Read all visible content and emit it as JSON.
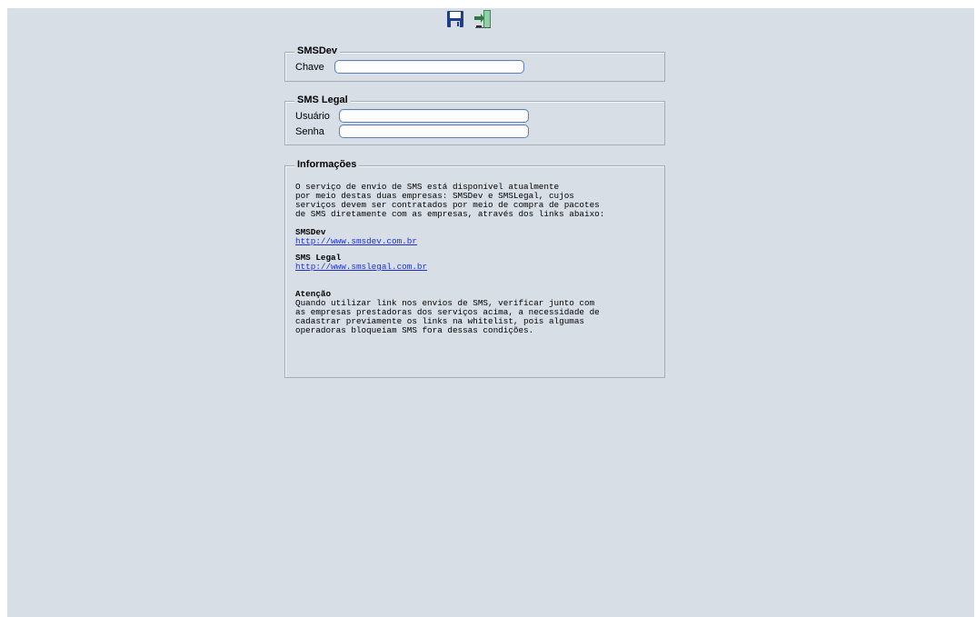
{
  "toolbar": {
    "save_icon": "floppy-disk-icon",
    "exit_icon": "exit-door-icon"
  },
  "smsdev": {
    "legend": "SMSDev",
    "chave_label": "Chave",
    "chave_value": ""
  },
  "smslegal": {
    "legend": "SMS Legal",
    "usuario_label": "Usuário",
    "usuario_value": "",
    "senha_label": "Senha",
    "senha_value": ""
  },
  "info": {
    "legend": "Informações",
    "intro_lines": [
      "O serviço de envio de SMS está disponível atualmente",
      "por meio destas duas empresas: SMSDev e SMSLegal, cujos",
      "serviços devem ser contratados por meio de compra de pacotes",
      "de SMS diretamente com as empresas, através dos links abaixo:"
    ],
    "smsdev_title": "SMSDev",
    "smsdev_link": "http://www.smsdev.com.br",
    "smslegal_title": "SMS Legal",
    "smslegal_link": "http://www.smslegal.com.br",
    "atencao_title": "Atenção",
    "atencao_lines": [
      "Quando utilizar link nos envios de SMS, verificar junto com",
      "as empresas prestadoras dos serviços acima, a necessidade de",
      "cadastrar previamente os links na whitelist, pois algumas",
      "operadoras bloqueiam SMS fora dessas condições."
    ]
  }
}
